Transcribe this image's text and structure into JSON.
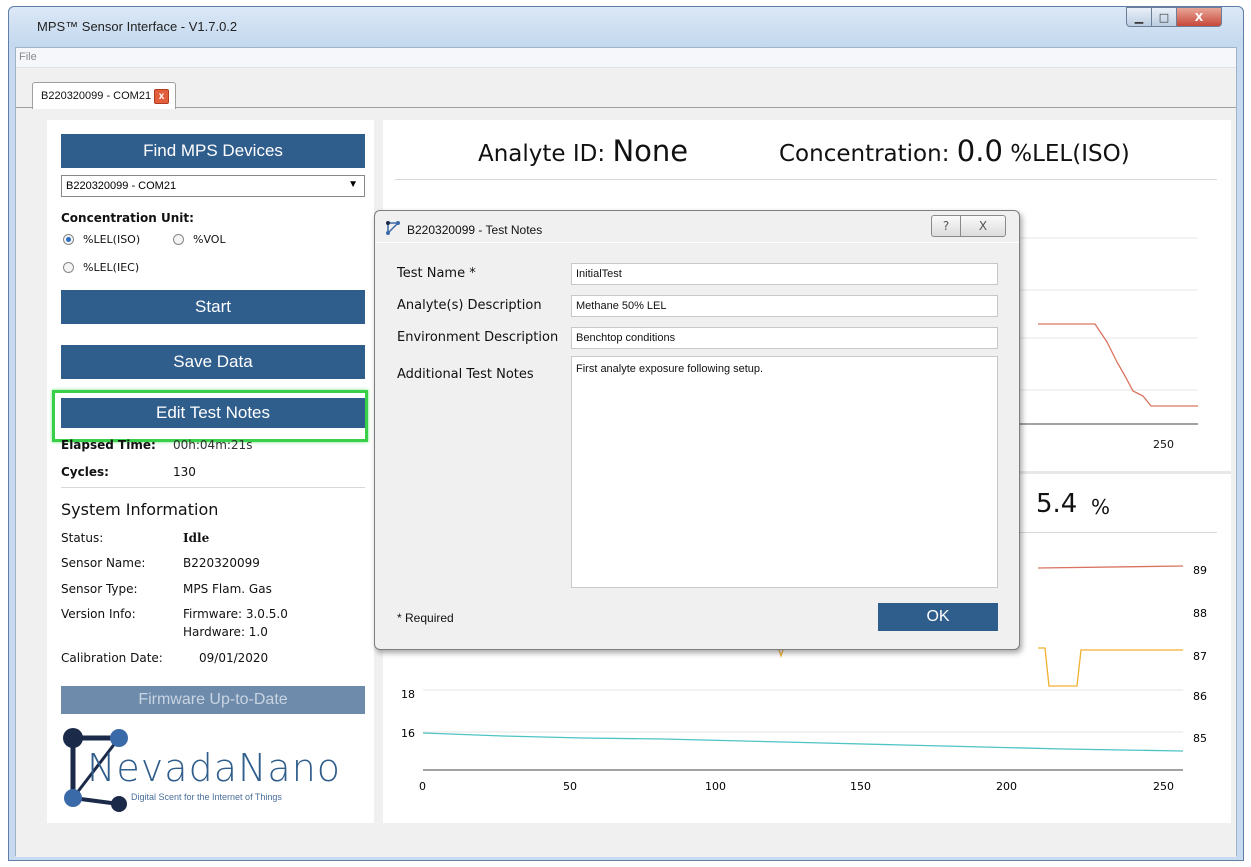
{
  "window": {
    "title": "MPS™ Sensor Interface - V1.7.0.2",
    "min": "▁",
    "max": "□",
    "close": "X"
  },
  "menu": {
    "file": "File"
  },
  "tab": {
    "label": "B220320099 - COM21",
    "close": "x"
  },
  "left": {
    "find_devices": "Find MPS Devices",
    "device_select": "B220320099 - COM21",
    "conc_unit_label": "Concentration Unit:",
    "units": [
      {
        "label": "%LEL(ISO)",
        "selected": true
      },
      {
        "label": "%VOL",
        "selected": false
      },
      {
        "label": "%LEL(IEC)",
        "selected": false
      }
    ],
    "start": "Start",
    "save_data": "Save Data",
    "edit_notes": "Edit Test Notes",
    "elapsed_label": "Elapsed Time:",
    "elapsed_value": "00h:04m:21s",
    "cycles_label": "Cycles:",
    "cycles_value": "130",
    "sysinfo_title": "System Information",
    "status_label": "Status:",
    "status_value": "Idle",
    "sensor_name_label": "Sensor Name:",
    "sensor_name_value": "B220320099",
    "sensor_type_label": "Sensor Type:",
    "sensor_type_value": "MPS Flam. Gas",
    "version_label": "Version Info:",
    "firmware_value": "Firmware: 3.0.5.0",
    "hardware_value": "Hardware: 1.0",
    "cal_label": "Calibration Date:",
    "cal_value": "09/01/2020",
    "firmware_btn": "Firmware Up-to-Date",
    "logo_text": "NevadaNano",
    "logo_tagline": "Digital Scent for the Internet of Things"
  },
  "right": {
    "analyte_label": "Analyte ID:",
    "analyte_value": "None",
    "conc_label": "Concentration:",
    "conc_value": "0.0",
    "conc_unit": "%LEL(ISO)",
    "humidity_partial": "5.4",
    "humidity_unit": "%",
    "top_chart_tick": "250",
    "bottom_left_ticks": [
      "18",
      "16"
    ],
    "bottom_right_ticks": [
      "89",
      "88",
      "87",
      "86",
      "85"
    ],
    "x_ticks": [
      "0",
      "50",
      "100",
      "150",
      "200",
      "250"
    ]
  },
  "dialog": {
    "title": "B220320099 - Test Notes",
    "help": "?",
    "close": "X",
    "test_name_label": "Test Name *",
    "test_name_value": "InitialTest",
    "analyte_desc_label": "Analyte(s) Description",
    "analyte_desc_value": "Methane 50% LEL",
    "env_desc_label": "Environment Description",
    "env_desc_value": "Benchtop conditions",
    "notes_label": "Additional Test Notes",
    "notes_value": "First analyte exposure following setup.",
    "required": "* Required",
    "ok": "OK"
  },
  "colors": {
    "accent": "#2f5d8c",
    "highlight": "#38d048",
    "red_line": "#d9735f",
    "orange_line": "#f0b030",
    "teal_line": "#4fc4c4"
  }
}
